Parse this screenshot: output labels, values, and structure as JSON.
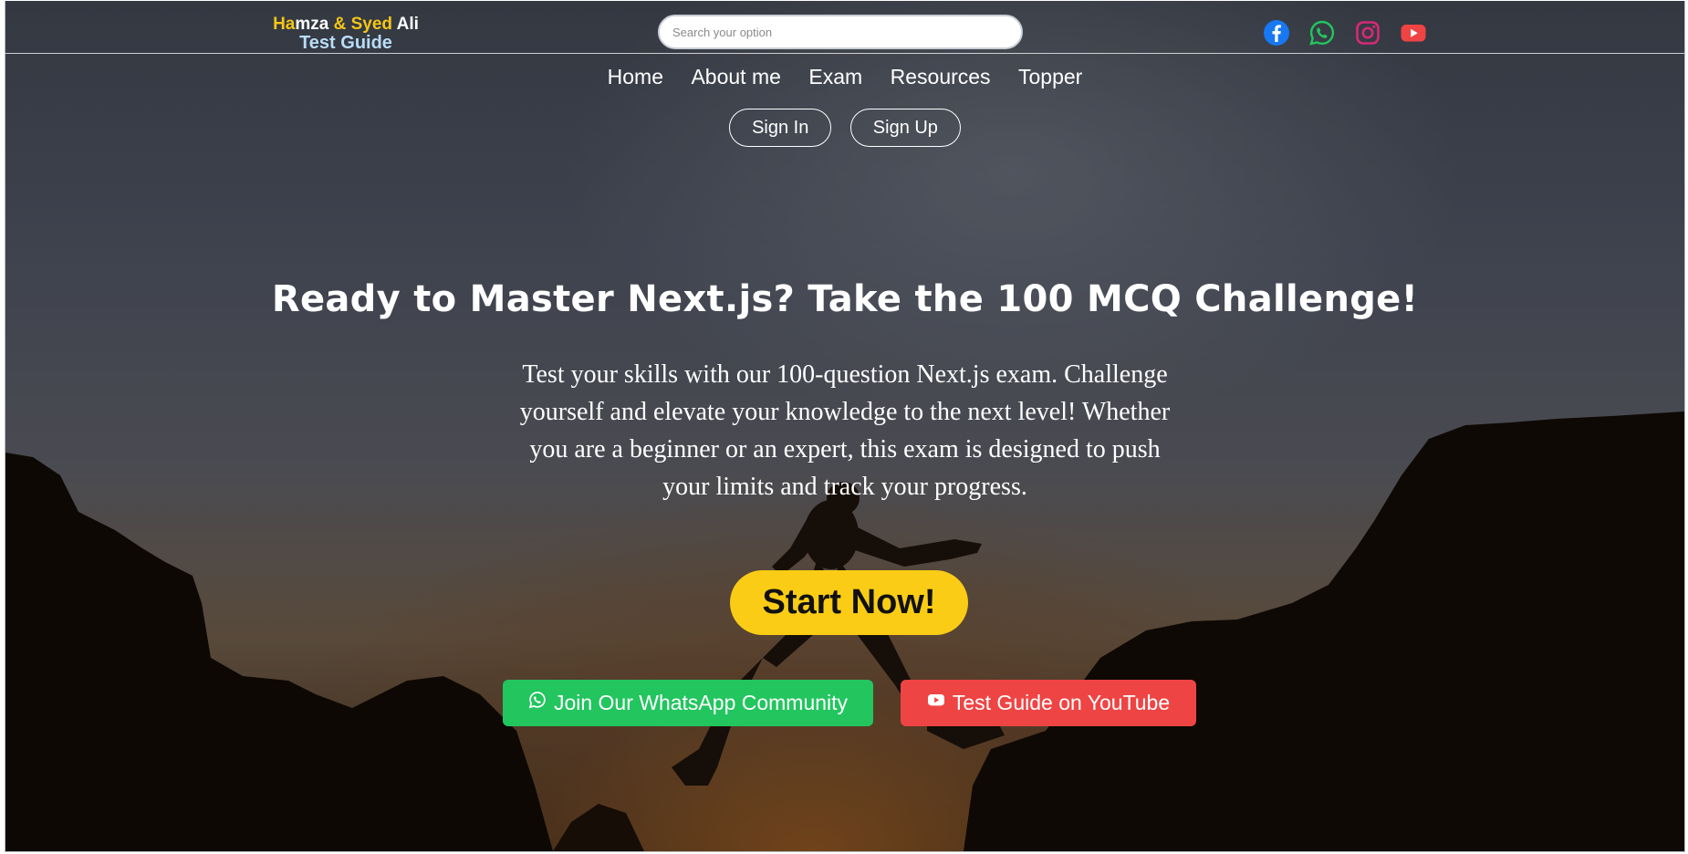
{
  "brand": {
    "line1": {
      "ha": "Ha",
      "mza": "mza",
      "amp": "& Syed",
      "ali": "Ali"
    },
    "line2": "Test Guide"
  },
  "search": {
    "placeholder": "Search your option",
    "value": ""
  },
  "socials": [
    {
      "name": "facebook",
      "icon": "facebook-icon",
      "color": "#1877f2"
    },
    {
      "name": "whatsapp",
      "icon": "whatsapp-icon",
      "color": "#22c55e"
    },
    {
      "name": "instagram",
      "icon": "instagram-icon",
      "color": "#d62976"
    },
    {
      "name": "youtube",
      "icon": "youtube-icon",
      "color": "#ef4444"
    }
  ],
  "nav": {
    "items": [
      {
        "label": "Home"
      },
      {
        "label": "About me"
      },
      {
        "label": "Exam"
      },
      {
        "label": "Resources"
      },
      {
        "label": "Topper"
      }
    ]
  },
  "auth": {
    "sign_in": "Sign In",
    "sign_up": "Sign Up"
  },
  "hero": {
    "headline": "Ready to Master Next.js? Take the 100 MCQ Challenge!",
    "description": "Test your skills with our 100-question Next.js exam. Challenge yourself and elevate your knowledge to the next level! Whether you are a beginner or an expert, this exam is designed to push your limits and track your progress.",
    "start_label": "Start Now!",
    "whatsapp_label": "Join Our WhatsApp Community",
    "youtube_label": "Test Guide on YouTube"
  },
  "colors": {
    "accent_yellow": "#facc15",
    "whatsapp_green": "#22c55e",
    "youtube_red": "#ef4444",
    "brand_blue": "#b9dcf7"
  }
}
